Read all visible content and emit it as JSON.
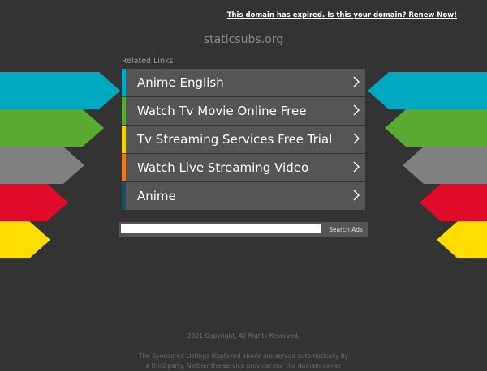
{
  "header": {
    "expired_link": "This domain has expired. Is this your domain? Renew Now!",
    "domain_name": "staticsubs.org"
  },
  "related": {
    "heading": "Related Links",
    "items": [
      {
        "label": "Anime English",
        "color": "#00a8c0"
      },
      {
        "label": "Watch Tv Movie Online Free",
        "color": "#5aaa32"
      },
      {
        "label": "Tv Streaming Services Free Trial",
        "color": "#f0d000"
      },
      {
        "label": "Watch Live Streaming Video",
        "color": "#e77a1e"
      },
      {
        "label": "Anime",
        "color": "#1e4a5a"
      }
    ]
  },
  "decor": {
    "arrow_colors": [
      "#00a8c0",
      "#5aaa32",
      "#808080",
      "#e00a2a",
      "#ffdd00"
    ]
  },
  "search": {
    "placeholder": "",
    "button_label": "Search Ads"
  },
  "footer": {
    "copyright": "2021 Copyright. All Rights Reserved.",
    "disclaimer": "The Sponsored Listings displayed above are served automatically by a third party. Neither the service provider nor the domain owner"
  }
}
